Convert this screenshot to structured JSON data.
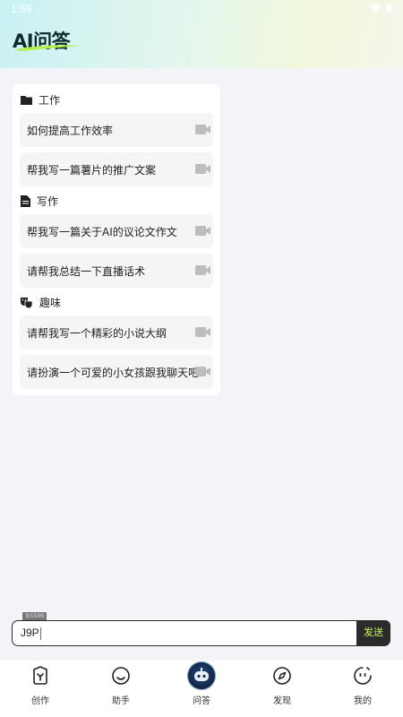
{
  "status_bar": {
    "time": "1:59"
  },
  "app": {
    "logo_text": "AI问答"
  },
  "sections": [
    {
      "title": "工作",
      "icon": "folder-icon",
      "items": [
        "如何提高工作效率",
        "帮我写一篇薯片的推广文案"
      ]
    },
    {
      "title": "写作",
      "icon": "document-icon",
      "items": [
        "帮我写一篇关于AI的议论文作文",
        "请帮我总结一下直播话术"
      ]
    },
    {
      "title": "趣味",
      "icon": "theater-masks-icon",
      "items": [
        "请帮我写一个精彩的小说大纲",
        "请扮演一个可爱的小女孩跟我聊天吧"
      ]
    }
  ],
  "input": {
    "counter": "3/1500",
    "value": "J9P",
    "send_label": "发送"
  },
  "bottom_nav": [
    {
      "label": "创作",
      "icon": "create-icon"
    },
    {
      "label": "助手",
      "icon": "assistant-smile-icon"
    },
    {
      "label": "问答",
      "icon": "robot-icon"
    },
    {
      "label": "发现",
      "icon": "compass-icon"
    },
    {
      "label": "我的",
      "icon": "profile-face-icon"
    }
  ],
  "colors": {
    "accent": "#c9f55a",
    "dark": "#2b2b2b",
    "background": "#f3f4f8"
  }
}
